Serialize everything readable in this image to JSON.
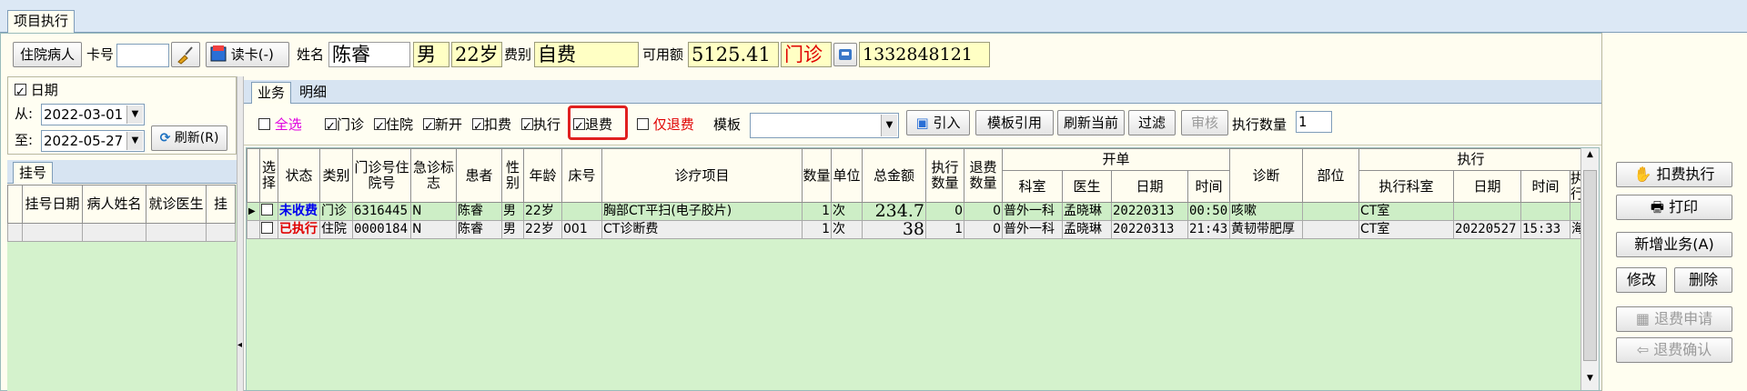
{
  "window": {
    "tab_label": "项目执行"
  },
  "patient": {
    "inpatient_btn": "住院病人",
    "card_label": "卡号",
    "card_value": "",
    "read_card_btn": "读卡(-)",
    "name_label": "姓名",
    "name": "陈睿",
    "sex": "男",
    "age": "22岁",
    "fee_type_label": "费别",
    "fee_type": "自费",
    "available_label": "可用额",
    "available": "5125.41",
    "visit_type": "门诊",
    "phone": "1332848121"
  },
  "left": {
    "date_check_label": "日期",
    "from_label": "从:",
    "from_value": "2022-03-01",
    "to_label": "至:",
    "to_value": "2022-05-27",
    "refresh_btn": "刷新(R)",
    "tab_register": "挂号",
    "columns": [
      "挂号日期",
      "病人姓名",
      "就诊医生",
      "挂"
    ]
  },
  "main": {
    "tabs": [
      "业务",
      "明细"
    ],
    "filters": {
      "select_all": "全选",
      "outpatient": "门诊",
      "inpatient": "住院",
      "new_open": "新开",
      "deduct": "扣费",
      "execute": "执行",
      "refund": "退费",
      "only_refund": "仅退费",
      "template_label": "模板",
      "import_btn": "引入",
      "template_ref_btn": "模板引用",
      "refresh_current_btn": "刷新当前",
      "filter_btn": "过滤",
      "review_btn": "审核",
      "exec_qty_label": "执行数量",
      "exec_qty_value": "1"
    },
    "header": {
      "select": "选择",
      "status": "状态",
      "category": "类别",
      "outpatient_no": "门诊号住院号",
      "emergency": "急诊标志",
      "patient": "患者",
      "sex": "性别",
      "age": "年龄",
      "bed": "床号",
      "item": "诊疗项目",
      "qty": "数量",
      "unit": "单位",
      "total": "总金额",
      "exec_qty": "执行数量",
      "refund_qty": "退费数量",
      "order_group": "开单",
      "dept": "科室",
      "doctor": "医生",
      "date": "日期",
      "time": "时间",
      "diagnosis": "诊断",
      "site": "部位",
      "exec_group": "执行",
      "exec_dept": "执行科室",
      "exec_date": "日期",
      "exec_time": "时间",
      "exec_by": "执行"
    },
    "rows": [
      {
        "status": "未收费",
        "category": "门诊",
        "no": "6316445",
        "emergency": "N",
        "patient": "陈睿",
        "sex": "男",
        "age": "22岁",
        "bed": "",
        "item": "胸部CT平扫(电子胶片)",
        "qty": "1",
        "unit": "次",
        "total": "234.7",
        "exec_qty": "0",
        "refund_qty": "0",
        "dept": "普外一科",
        "doctor": "孟晓琳",
        "date": "20220313",
        "time": "00:50",
        "diagnosis": "咳嗽",
        "site": "",
        "exec_dept": "CT室",
        "exec_date": "",
        "exec_time": "",
        "exec_by": ""
      },
      {
        "status": "已执行",
        "category": "住院",
        "no": "0000184",
        "emergency": "N",
        "patient": "陈睿",
        "sex": "男",
        "age": "22岁",
        "bed": "001",
        "item": "CT诊断费",
        "qty": "1",
        "unit": "次",
        "total": "38",
        "exec_qty": "1",
        "refund_qty": "0",
        "dept": "普外一科",
        "doctor": "孟晓琳",
        "date": "20220313",
        "time": "21:43",
        "diagnosis": "黄韧带肥厚",
        "site": "",
        "exec_dept": "CT室",
        "exec_date": "20220527",
        "exec_time": "15:33",
        "exec_by": "海泉"
      }
    ]
  },
  "right": {
    "deduct_exec_btn": "扣费执行",
    "print_btn": "打印",
    "new_business_btn": "新增业务(A)",
    "modify_btn": "修改",
    "delete_btn": "删除",
    "refund_apply_btn": "退费申请",
    "refund_confirm_btn": "退费确认"
  },
  "colors": {
    "accent_border": "#e02020",
    "unpaid": "#0000ee",
    "executed": "#e00000",
    "select_all": "#e000e0",
    "only_refund": "#e00000",
    "row_highlight": "#cdeec6",
    "grid_bg": "#d4f2cc"
  }
}
